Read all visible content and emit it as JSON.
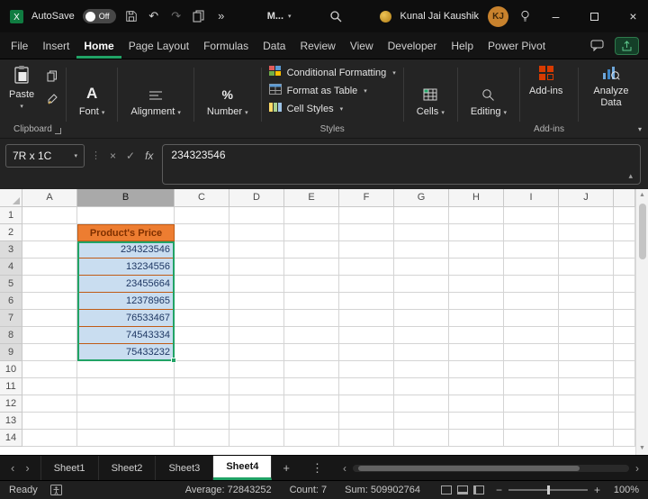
{
  "colors": {
    "accent_green": "#21A366",
    "orange_fill": "#ED7D31",
    "orange_text": "#7F3000",
    "orange_border": "#BF5B16",
    "selection_fill": "#C9DDF0",
    "value_text": "#1F3864",
    "addins_orange": "#D83B01"
  },
  "titlebar": {
    "autosave_label": "AutoSave",
    "autosave_state": "Off",
    "workbook_menu": "M...",
    "user_name": "Kunal Jai Kaushik",
    "user_initials": "KJ"
  },
  "menubar": {
    "tabs": [
      "File",
      "Insert",
      "Home",
      "Page Layout",
      "Formulas",
      "Data",
      "Review",
      "View",
      "Developer",
      "Help",
      "Power Pivot"
    ],
    "active_tab": "Home"
  },
  "ribbon": {
    "paste": "Paste",
    "font": "Font",
    "alignment": "Alignment",
    "number": "Number",
    "styles_buttons": [
      "Conditional Formatting",
      "Format as Table",
      "Cell Styles"
    ],
    "cells": "Cells",
    "editing": "Editing",
    "addins": "Add-ins",
    "analyze": "Analyze Data",
    "group_clipboard": "Clipboard",
    "group_styles": "Styles",
    "group_addins": "Add-ins"
  },
  "formula_bar": {
    "name_box": "7R x 1C",
    "fx": "fx",
    "value": "234323546"
  },
  "grid": {
    "column_headers": [
      "A",
      "B",
      "C",
      "D",
      "E",
      "F",
      "G",
      "H",
      "I",
      "J"
    ],
    "row_count": 14,
    "header_cell": {
      "ref": "B2",
      "text": "Product's Price"
    },
    "cells": [
      {
        "ref": "B3",
        "value": "234323546"
      },
      {
        "ref": "B4",
        "value": "13234556"
      },
      {
        "ref": "B5",
        "value": "23455664"
      },
      {
        "ref": "B6",
        "value": "12378965"
      },
      {
        "ref": "B7",
        "value": "76533467"
      },
      {
        "ref": "B8",
        "value": "74543334"
      },
      {
        "ref": "B9",
        "value": "75433232"
      }
    ],
    "selection": {
      "range": "B3:B9"
    }
  },
  "sheet_tabs": {
    "tabs": [
      "Sheet1",
      "Sheet2",
      "Sheet3",
      "Sheet4"
    ],
    "active": "Sheet4"
  },
  "status_bar": {
    "mode": "Ready",
    "average": "Average: 72843252",
    "count": "Count: 7",
    "sum": "Sum: 509902764",
    "zoom": "100%"
  }
}
